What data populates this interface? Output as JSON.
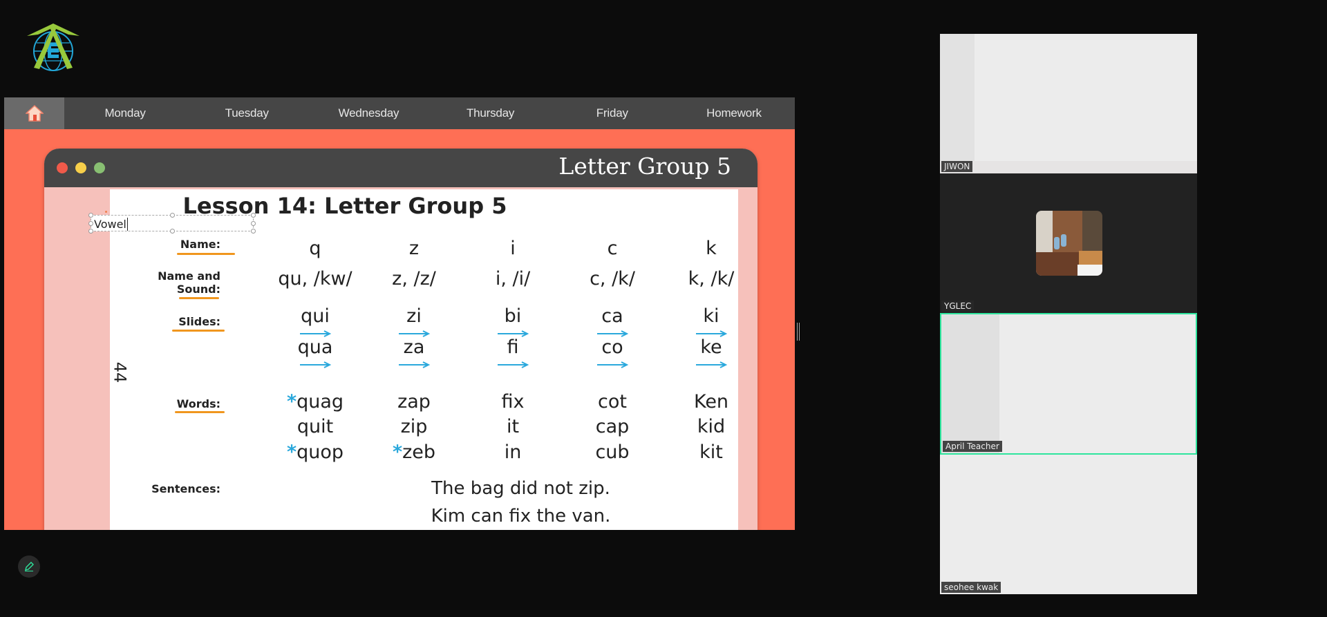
{
  "app": {
    "logo_icon": "globe-arrow-e-logo"
  },
  "nav": {
    "home_icon": "home-icon",
    "items": [
      "Monday",
      "Tuesday",
      "Wednesday",
      "Thursday",
      "Friday",
      "Homework"
    ]
  },
  "slide": {
    "window_title": "Letter Group 5",
    "lesson_title": "Lesson 14: Letter Group 5",
    "page_number": "44",
    "textbox_value": "Vowel",
    "labels": {
      "name": "Name:",
      "name_sound_1": "Name and",
      "name_sound_2": "Sound:",
      "slides": "Slides:",
      "words": "Words:",
      "sentences": "Sentences:"
    },
    "names": [
      "q",
      "z",
      "i",
      "c",
      "k"
    ],
    "name_sound": [
      "qu, /kw/",
      "z, /z/",
      "i, /i/",
      "c, /k/",
      "k, /k/"
    ],
    "slides_row1": [
      "qui",
      "zi",
      "bi",
      "ca",
      "ki"
    ],
    "slides_row2": [
      "qua",
      "za",
      "fi",
      "co",
      "ke"
    ],
    "words_row1": [
      "quag",
      "zap",
      "fix",
      "cot",
      "Ken"
    ],
    "words_row2": [
      "quit",
      "zip",
      "it",
      "cap",
      "kid"
    ],
    "words_row3": [
      "quop",
      "zeb",
      "in",
      "cub",
      "kit"
    ],
    "star": "*",
    "sentences": [
      "The bag did not zip.",
      "Kim can fix the van."
    ]
  },
  "participants": [
    {
      "name": "JIWON"
    },
    {
      "name": "YGLEC"
    },
    {
      "name": "April Teacher",
      "active": true
    },
    {
      "name": "seohee kwak"
    }
  ],
  "colors": {
    "accent_orange": "#fe6f55",
    "active_speaker": "#2ee59d",
    "nav_bg": "#464646"
  }
}
